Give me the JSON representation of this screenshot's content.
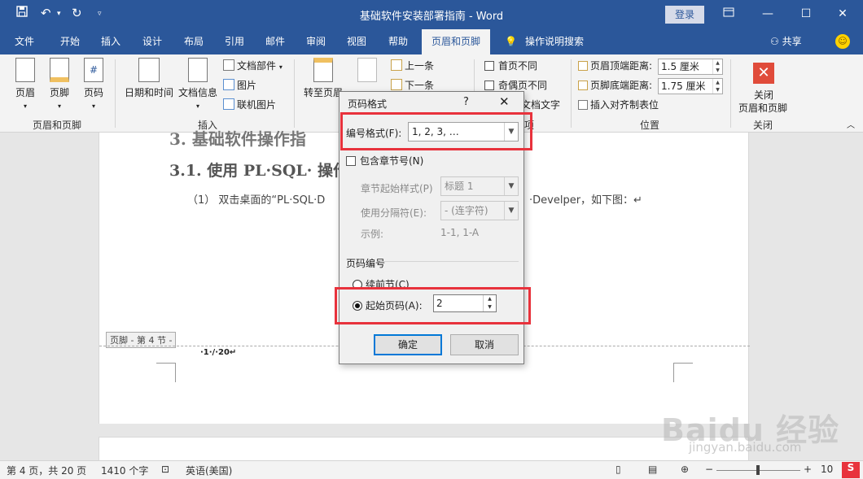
{
  "window": {
    "title": "基础软件安装部署指南 - Word",
    "login": "登录"
  },
  "quick_access": [
    "save-icon",
    "undo-icon",
    "redo-icon",
    "customize-icon"
  ],
  "tabs": [
    "文件",
    "开始",
    "插入",
    "设计",
    "布局",
    "引用",
    "邮件",
    "审阅",
    "视图",
    "帮助",
    "页眉和页脚",
    "操作说明搜索"
  ],
  "share": "共享",
  "ribbon": {
    "group1": {
      "buttons": [
        "页眉",
        "页脚",
        "页码"
      ],
      "label": "页眉和页脚"
    },
    "group2": {
      "datetime": "日期和时间",
      "docinfo": "文档信息",
      "docparts": "文档部件",
      "picture": "图片",
      "online_picture": "联机图片",
      "label": "插入"
    },
    "group3": {
      "goto_header": "转至页眉",
      "prev": "上一条",
      "next": "下一条"
    },
    "group4": {
      "first_page": "首页不同",
      "odd_even": "奇偶页不同",
      "show_text": "文档文字",
      "label": "项"
    },
    "group5": {
      "header_top": "页眉顶端距离:",
      "header_top_val": "1.5 厘米",
      "footer_bottom": "页脚底端距离:",
      "footer_bottom_val": "1.75 厘米",
      "align_tab": "插入对齐制表位",
      "label": "位置"
    },
    "group6": {
      "close_line1": "关闭",
      "close_line2": "页眉和页脚",
      "label": "关闭"
    }
  },
  "document": {
    "heading_partial": "3.  基础软件操作指",
    "heading2": "3.1. 使用 PL·SQL· 操作",
    "para_left": "（1）   双击桌面的“PL·SQL·D",
    "para_right": "·Develper，如下图：↵",
    "footer_tag": "页脚 - 第 4 节 -",
    "page_number": "·1·/·20↵"
  },
  "dialog": {
    "title": "页码格式",
    "help": "?",
    "number_format_label": "编号格式(F):",
    "number_format_value": "1, 2, 3, …",
    "include_chapter": "包含章节号(N)",
    "chapter_style_label": "章节起始样式(P)",
    "chapter_style_value": "标题 1",
    "separator_label": "使用分隔符(E):",
    "separator_value": "-   (连字符)",
    "example_label": "示例:",
    "example_value": "1-1, 1-A",
    "page_numbering": "页码编号",
    "continue": "续前节(C)",
    "start_at": "起始页码(A):",
    "start_at_value": "2",
    "ok": "确定",
    "cancel": "取消"
  },
  "statusbar": {
    "page": "第 4 页，共 20 页",
    "words": "1410 个字",
    "language": "英语(美国)",
    "zoom_partial": "10"
  },
  "watermark": {
    "brand": "Baidu 经验",
    "url": "jingyan.baidu.com"
  },
  "colors": {
    "accent": "#2b579a",
    "highlight": "#e8323c"
  }
}
